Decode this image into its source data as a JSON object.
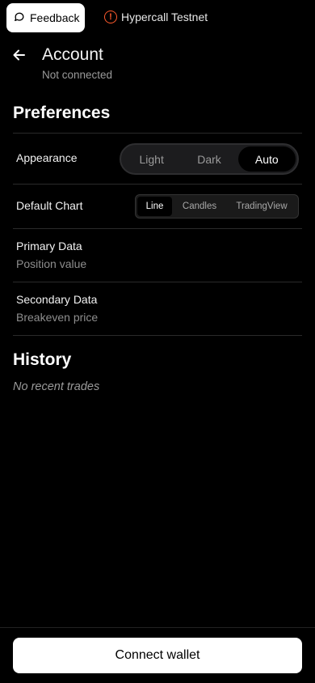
{
  "topbar": {
    "feedback_label": "Feedback",
    "network_label": "Hypercall Testnet",
    "network_icon_glyph": "!",
    "warning_color": "#ff5a2c"
  },
  "header": {
    "title": "Account",
    "subtitle": "Not connected"
  },
  "preferences": {
    "title": "Preferences",
    "appearance": {
      "label": "Appearance",
      "options": [
        "Light",
        "Dark",
        "Auto"
      ],
      "selected": "Auto"
    },
    "default_chart": {
      "label": "Default Chart",
      "options": [
        "Line",
        "Candles",
        "TradingView"
      ],
      "selected": "Line"
    },
    "primary_data": {
      "label": "Primary Data",
      "value": "Position value"
    },
    "secondary_data": {
      "label": "Secondary Data",
      "value": "Breakeven price"
    }
  },
  "history": {
    "title": "History",
    "empty_text": "No recent trades"
  },
  "footer": {
    "connect_label": "Connect wallet"
  },
  "icons": {
    "feedback": "chat-bubble-icon",
    "network": "warning-icon",
    "back": "arrow-left-icon"
  }
}
